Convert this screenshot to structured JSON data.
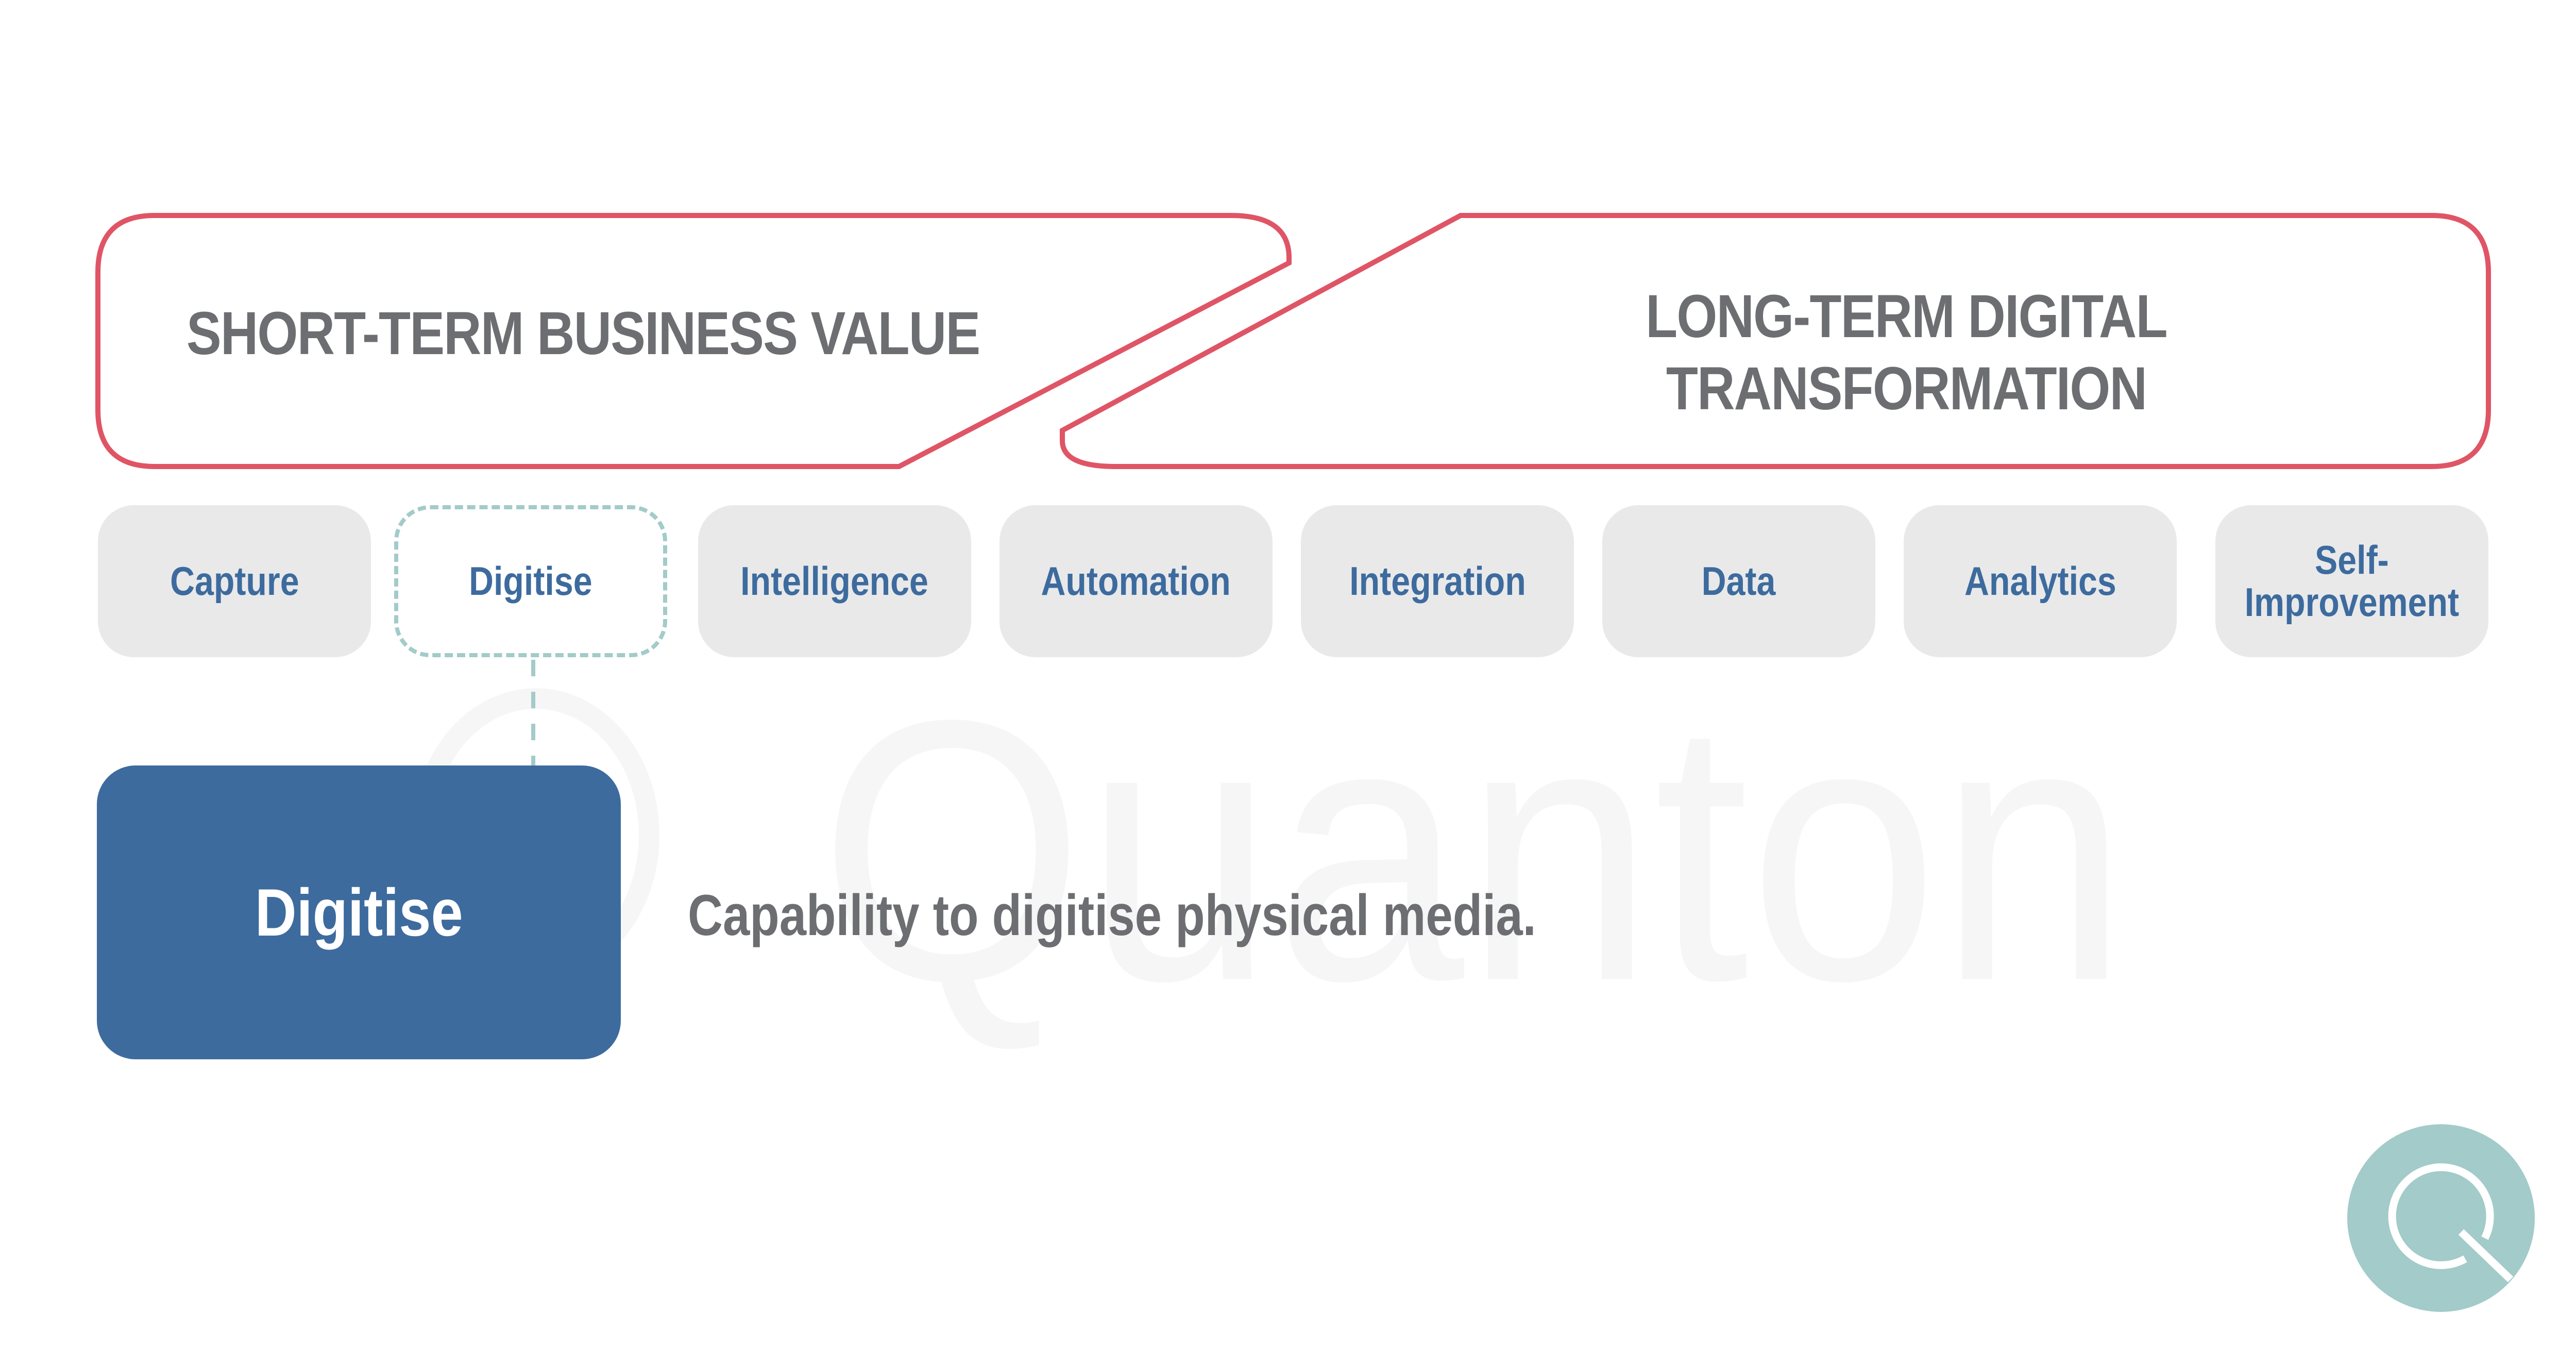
{
  "banners": {
    "short_term": {
      "title": "SHORT-TERM BUSINESS VALUE"
    },
    "long_term": {
      "title_line1": "LONG-TERM DIGITAL",
      "title_line2": "TRANSFORMATION"
    }
  },
  "capabilities": [
    {
      "label": "Capture",
      "selected": false
    },
    {
      "label": "Digitise",
      "selected": true
    },
    {
      "label": "Intelligence",
      "selected": false
    },
    {
      "label": "Automation",
      "selected": false
    },
    {
      "label": "Integration",
      "selected": false
    },
    {
      "label": "Data",
      "selected": false
    },
    {
      "label": "Analytics",
      "selected": false
    },
    {
      "label": "Self-\nImprovement",
      "selected": false
    }
  ],
  "detail": {
    "title": "Digitise",
    "description": "Capability to digitise physical media."
  },
  "watermark": {
    "symbol": "©",
    "text": "Quanton"
  },
  "logo": {
    "icon": "quanton-q-logo",
    "letter": "Q"
  },
  "colors": {
    "banner_outline": "#df5566",
    "heading_gray": "#6d6e71",
    "pill_bg": "#e9e9ea",
    "pill_text": "#3d6b9e",
    "selected_dash": "#a2cbc9",
    "detail_bg": "#3d6b9e",
    "logo_teal": "#a2cbc9"
  }
}
